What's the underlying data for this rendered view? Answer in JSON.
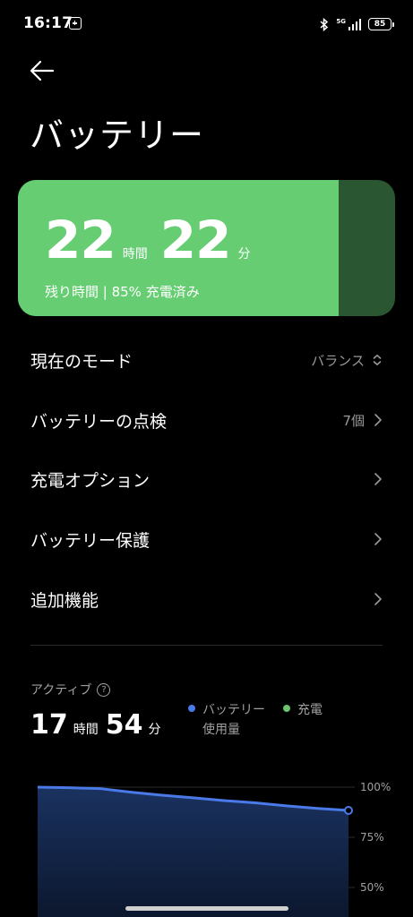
{
  "status_bar": {
    "time": "16:17",
    "network": "5G",
    "battery_level": "85"
  },
  "header": {
    "title": "バッテリー"
  },
  "battery_card": {
    "hours": "22",
    "hours_unit": "時間",
    "minutes": "22",
    "minutes_unit": "分",
    "subtitle": "残り時間 | 85% 充電済み",
    "charge_fraction": 0.85,
    "fill_color": "#66cd72",
    "empty_color": "#2a5631"
  },
  "menu": {
    "items": [
      {
        "label": "現在のモード",
        "value": "バランス",
        "icon": "updown-icon"
      },
      {
        "label": "バッテリーの点検",
        "value": "7個",
        "icon": "chevron-right-icon"
      },
      {
        "label": "充電オプション",
        "value": "",
        "icon": "chevron-right-icon"
      },
      {
        "label": "バッテリー保護",
        "value": "",
        "icon": "chevron-right-icon"
      },
      {
        "label": "追加機能",
        "value": "",
        "icon": "chevron-right-icon"
      }
    ]
  },
  "active": {
    "label": "アクティブ",
    "hours": "17",
    "hours_unit": "時間",
    "minutes": "54",
    "minutes_unit": "分"
  },
  "legend": {
    "usage_line1": "バッテリー",
    "usage_line2": "使用量",
    "usage_color": "#4a79e8",
    "charging": "充電",
    "charging_color": "#6cc46f"
  },
  "chart_data": {
    "type": "area",
    "y_ticks": [
      "100%",
      "75%",
      "50%"
    ],
    "ylim": [
      40,
      100
    ],
    "x": [
      0,
      1,
      2,
      3,
      4,
      5,
      6,
      7,
      8,
      9,
      10
    ],
    "values": [
      100,
      99.7,
      99.3,
      97.5,
      96,
      94.7,
      93.3,
      92.2,
      90.7,
      89.4,
      88.4
    ],
    "series_color": "#4a79e8"
  }
}
